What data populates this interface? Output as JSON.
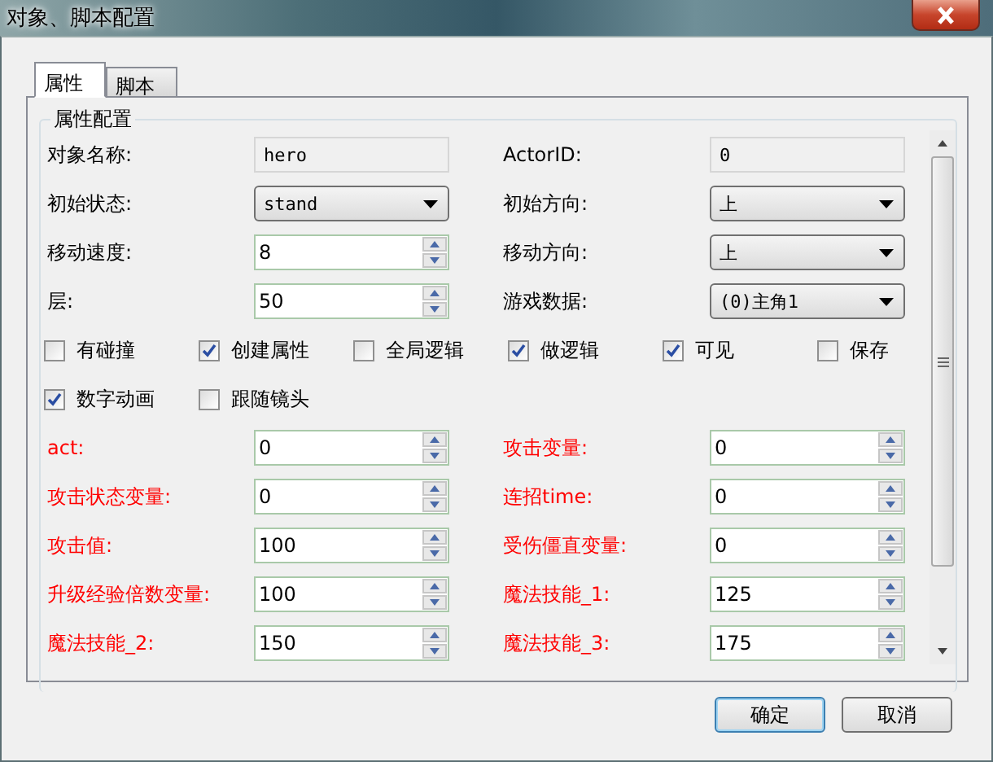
{
  "window": {
    "title": "对象、脚本配置"
  },
  "tabs": [
    {
      "label": "属性",
      "selected": true
    },
    {
      "label": "脚本",
      "selected": false
    }
  ],
  "group": {
    "title": "属性配置"
  },
  "fields_top": [
    {
      "label": "对象名称:",
      "kind": "readonly",
      "value": "hero",
      "color": "#000000"
    },
    {
      "label": "ActorID:",
      "kind": "readonly",
      "value": "0",
      "color": "#000000"
    },
    {
      "label": "初始状态:",
      "kind": "combo",
      "value": "stand",
      "color": "#000000"
    },
    {
      "label": "初始方向:",
      "kind": "combo",
      "value": "上",
      "color": "#000000"
    },
    {
      "label": "移动速度:",
      "kind": "spin",
      "value": "8",
      "color": "#000000"
    },
    {
      "label": "移动方向:",
      "kind": "combo",
      "value": "上",
      "color": "#000000"
    },
    {
      "label": "层:",
      "kind": "spin",
      "value": "50",
      "color": "#000000"
    },
    {
      "label": "游戏数据:",
      "kind": "combo",
      "value": "(0)主角1",
      "color": "#000000"
    }
  ],
  "checkboxes": [
    {
      "label": "有碰撞",
      "checked": false
    },
    {
      "label": "创建属性",
      "checked": true
    },
    {
      "label": "全局逻辑",
      "checked": false
    },
    {
      "label": "做逻辑",
      "checked": true
    },
    {
      "label": "可见",
      "checked": true
    },
    {
      "label": "保存",
      "checked": false
    },
    {
      "label": "数字动画",
      "checked": true
    },
    {
      "label": "跟随镜头",
      "checked": false
    }
  ],
  "fields_bottom": [
    {
      "label": "act:",
      "kind": "spin",
      "value": "0",
      "color": "#ff0000"
    },
    {
      "label": "攻击变量:",
      "kind": "spin",
      "value": "0",
      "color": "#ff0000"
    },
    {
      "label": "攻击状态变量:",
      "kind": "spin",
      "value": "0",
      "color": "#ff0000"
    },
    {
      "label": "连招time:",
      "kind": "spin",
      "value": "0",
      "color": "#ff0000"
    },
    {
      "label": "攻击值:",
      "kind": "spin",
      "value": "100",
      "color": "#ff0000"
    },
    {
      "label": "受伤僵直变量:",
      "kind": "spin",
      "value": "0",
      "color": "#ff0000"
    },
    {
      "label": "升级经验倍数变量:",
      "kind": "spin",
      "value": "100",
      "color": "#ff0000"
    },
    {
      "label": "魔法技能_1:",
      "kind": "spin",
      "value": "125",
      "color": "#ff0000"
    },
    {
      "label": "魔法技能_2:",
      "kind": "spin",
      "value": "150",
      "color": "#ff0000"
    },
    {
      "label": "魔法技能_3:",
      "kind": "spin",
      "value": "175",
      "color": "#ff0000"
    }
  ],
  "buttons": [
    {
      "label": "确定",
      "default": true
    },
    {
      "label": "取消",
      "default": false
    }
  ]
}
